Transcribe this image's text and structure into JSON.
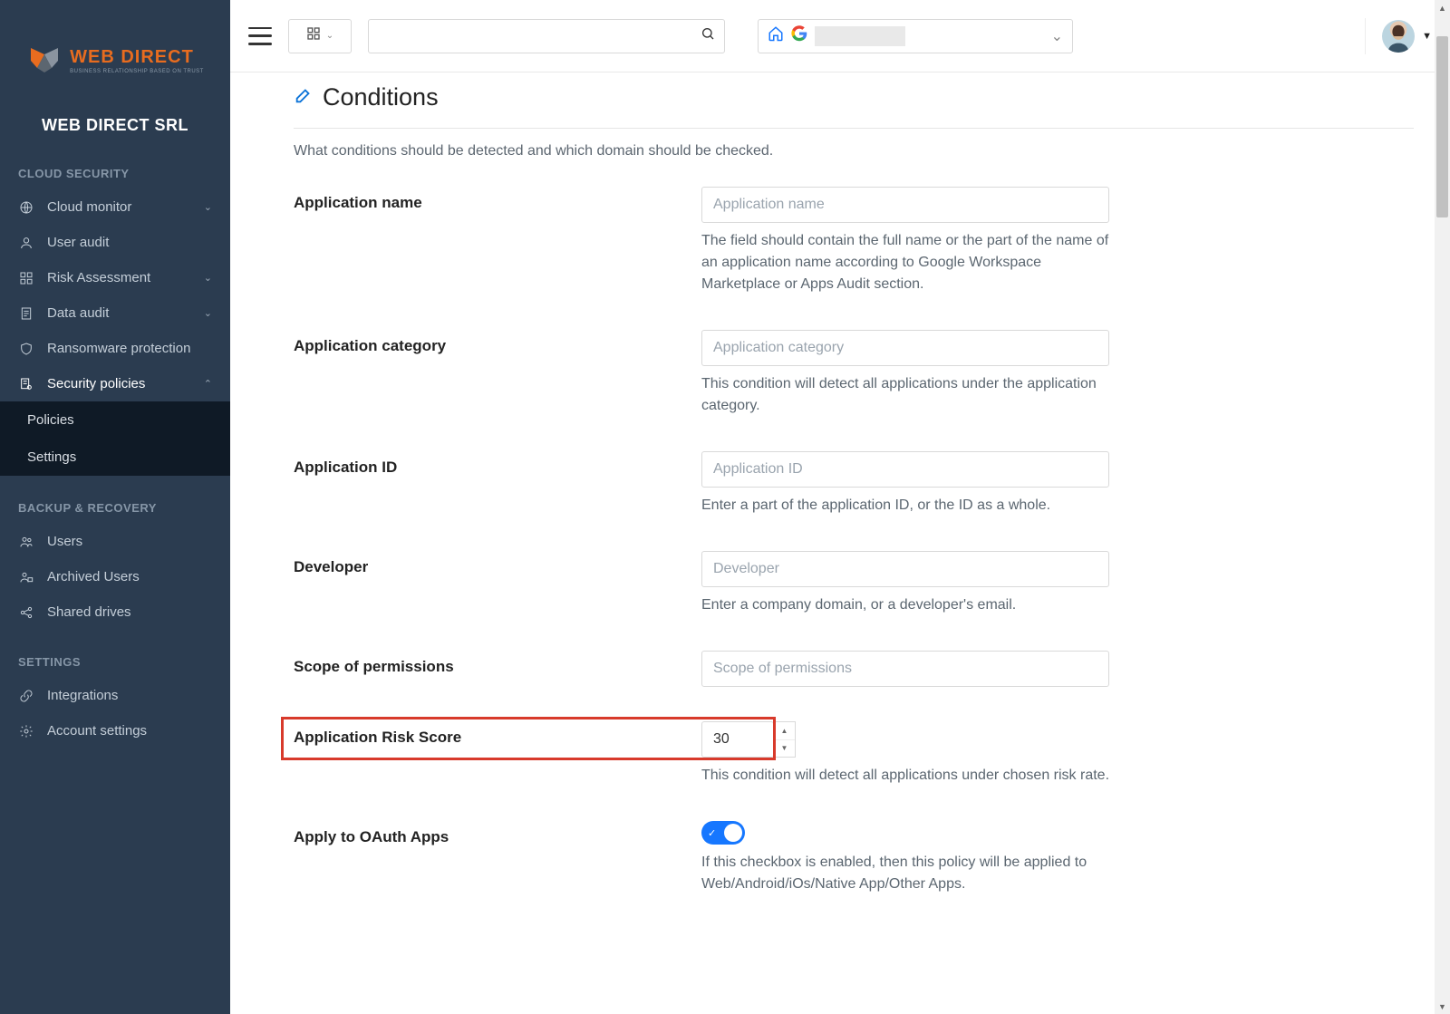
{
  "brand": {
    "name": "WEB DIRECT",
    "tagline": "BUSINESS RELATIONSHIP BASED ON TRUST",
    "org": "WEB DIRECT SRL"
  },
  "sidebar": {
    "section1": {
      "heading": "CLOUD SECURITY",
      "items": [
        {
          "label": "Cloud monitor",
          "has_chevron": true
        },
        {
          "label": "User audit"
        },
        {
          "label": "Risk Assessment",
          "has_chevron": true
        },
        {
          "label": "Data audit",
          "has_chevron": true
        },
        {
          "label": "Ransomware protection"
        },
        {
          "label": "Security policies",
          "expanded": true,
          "subitems": [
            "Policies",
            "Settings"
          ]
        }
      ]
    },
    "section2": {
      "heading": "BACKUP & RECOVERY",
      "items": [
        {
          "label": "Users"
        },
        {
          "label": "Archived Users"
        },
        {
          "label": "Shared drives"
        }
      ]
    },
    "section3": {
      "heading": "SETTINGS",
      "items": [
        {
          "label": "Integrations"
        },
        {
          "label": "Account settings"
        }
      ]
    }
  },
  "topbar": {
    "search_placeholder": ""
  },
  "conditions": {
    "title": "Conditions",
    "description": "What conditions should be detected and which domain should be checked.",
    "fields": {
      "app_name": {
        "label": "Application name",
        "placeholder": "Application name",
        "help": "The field should contain the full name or the part of the name of an application name according to Google Workspace Marketplace or Apps Audit section."
      },
      "app_category": {
        "label": "Application category",
        "placeholder": "Application category",
        "help": "This condition will detect all applications under the application category."
      },
      "app_id": {
        "label": "Application ID",
        "placeholder": "Application ID",
        "help": "Enter a part of the application ID, or the ID as a whole."
      },
      "developer": {
        "label": "Developer",
        "placeholder": "Developer",
        "help": "Enter a company domain, or a developer's email."
      },
      "scope": {
        "label": "Scope of permissions",
        "placeholder": "Scope of permissions"
      },
      "risk_score": {
        "label": "Application Risk Score",
        "value": "30",
        "help": "This condition will detect all applications under chosen risk rate."
      },
      "oauth": {
        "label": "Apply to OAuth Apps",
        "enabled": true,
        "help": "If this checkbox is enabled, then this policy will be applied to Web/Android/iOs/Native App/Other Apps."
      }
    }
  }
}
